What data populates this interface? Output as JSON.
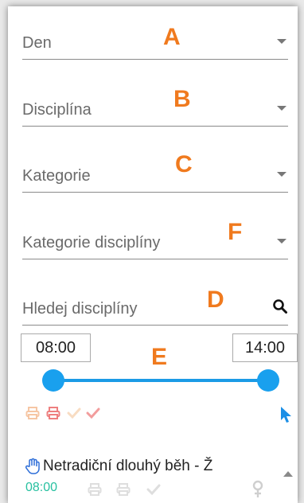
{
  "filters": {
    "day": {
      "label": "Den",
      "tag": "A"
    },
    "discipline": {
      "label": "Disciplína",
      "tag": "B"
    },
    "category": {
      "label": "Kategorie",
      "tag": "C"
    },
    "discipline_category": {
      "label": "Kategorie disciplíny",
      "tag": "F"
    },
    "search": {
      "placeholder": "Hledej disciplíny",
      "tag": "D"
    }
  },
  "time_range": {
    "from": "08:00",
    "to": "14:00",
    "tag": "E",
    "start_fraction": 0.0,
    "end_fraction": 1.0
  },
  "legend_icons": [
    "print-icon-light",
    "print-icon",
    "check-icon-light",
    "check-icon"
  ],
  "list": {
    "items": [
      {
        "title": "Netradiční dlouhý běh - Ž",
        "time": "08:00"
      }
    ]
  },
  "colors": {
    "accent": "#19a0ee",
    "tag": "#f07a1e",
    "time_text": "#27c0a0"
  }
}
